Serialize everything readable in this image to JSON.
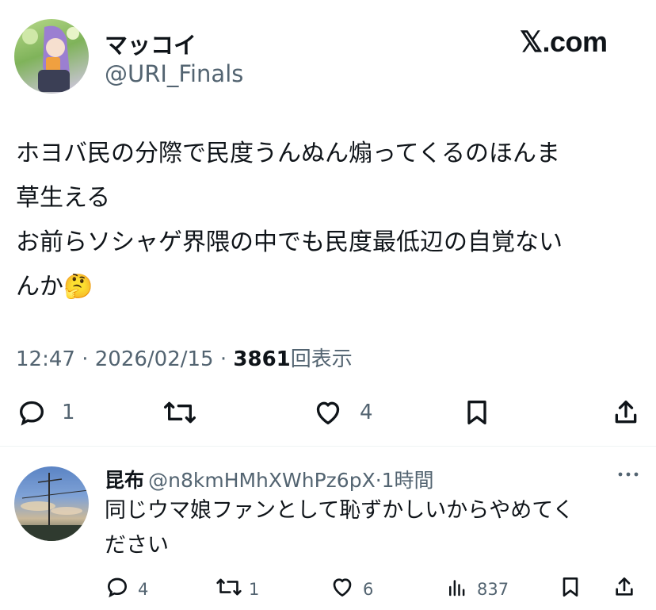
{
  "header": {
    "display_name": "マッコイ",
    "handle": "@URI_Finals",
    "brand": "𝕏.com"
  },
  "tweet": {
    "text": "ホヨバ民の分際で民度うんぬん煽ってくるのほんま\n草生える\nお前らソシャゲ界隈の中でも民度最低辺の自覚ない\nんか",
    "emoji": "🤔",
    "time": "12:47",
    "date": "2026/02/15",
    "views_count": "3861",
    "views_label": "回表示",
    "separator": "·"
  },
  "actions": {
    "reply_count": "1",
    "retweet_count": "",
    "like_count": "4"
  },
  "reply": {
    "display_name": "昆布",
    "handle": "@n8kmHMhXWhPz6pX",
    "separator": "·",
    "time_ago": "1時間",
    "more_icon": "more-dots-icon",
    "text": "同じウマ娘ファンとして恥ずかしいからやめてく\nださい",
    "reply_count": "4",
    "retweet_count": "1",
    "like_count": "6",
    "view_count": "837"
  },
  "colors": {
    "text_primary": "#0f1419",
    "text_secondary": "#536471",
    "divider": "#eff3f4"
  }
}
